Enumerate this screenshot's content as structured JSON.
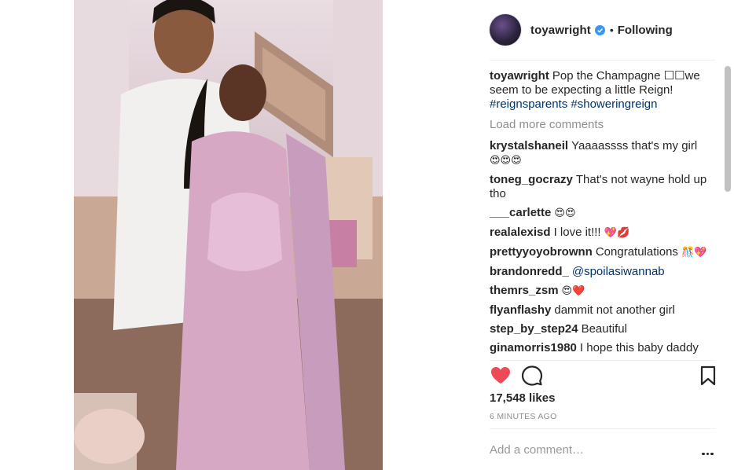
{
  "post": {
    "username": "toyawright",
    "follow_status": "Following",
    "separator": "•",
    "caption": {
      "username": "toyawright",
      "text": "Pop the Champagne ☐☐we seem to be expecting a little Reign!",
      "hashtags": [
        "#reignsparents",
        "#showeringreign"
      ]
    },
    "load_more": "Load more comments",
    "comments": [
      {
        "user": "krystalshaneil",
        "text": "Yaaaassss that's my girl",
        "emoji": "😍😍😍"
      },
      {
        "user": "toneg_gocrazy",
        "text": "That's not wayne hold up tho",
        "emoji": ""
      },
      {
        "user": "___carlette",
        "text": "",
        "emoji": "😍😍"
      },
      {
        "user": "realalexisd",
        "text": "I love it!!!",
        "emoji": "💖💋"
      },
      {
        "user": "prettyyoyobrownn",
        "text": "Congratulations",
        "emoji": "🎊💖"
      },
      {
        "user": "brandonredd_",
        "text": "",
        "mention": "@spoilasiwannab",
        "emoji": ""
      },
      {
        "user": "themrs_zsm",
        "text": "",
        "emoji": "😍❤️"
      },
      {
        "user": "flyanflashy",
        "text": "dammit not another girl",
        "emoji": ""
      },
      {
        "user": "step_by_step24",
        "text": "Beautiful",
        "emoji": ""
      },
      {
        "user": "ginamorris1980",
        "text": "I hope this baby daddy actually want you , you didn't think that",
        "emoji": ""
      }
    ],
    "likes": "17,548 likes",
    "timestamp": "6 MINUTES AGO",
    "add_comment_placeholder": "Add a comment…"
  },
  "icons": {
    "like": "heart-filled-icon",
    "comment": "comment-bubble-icon",
    "save": "bookmark-icon",
    "verified": "verified-badge-icon",
    "more": "more-options-icon"
  },
  "colors": {
    "like_red": "#ed4956",
    "verified_blue": "#3897f0",
    "hashtag": "#003569",
    "muted": "#8e8e8e"
  }
}
